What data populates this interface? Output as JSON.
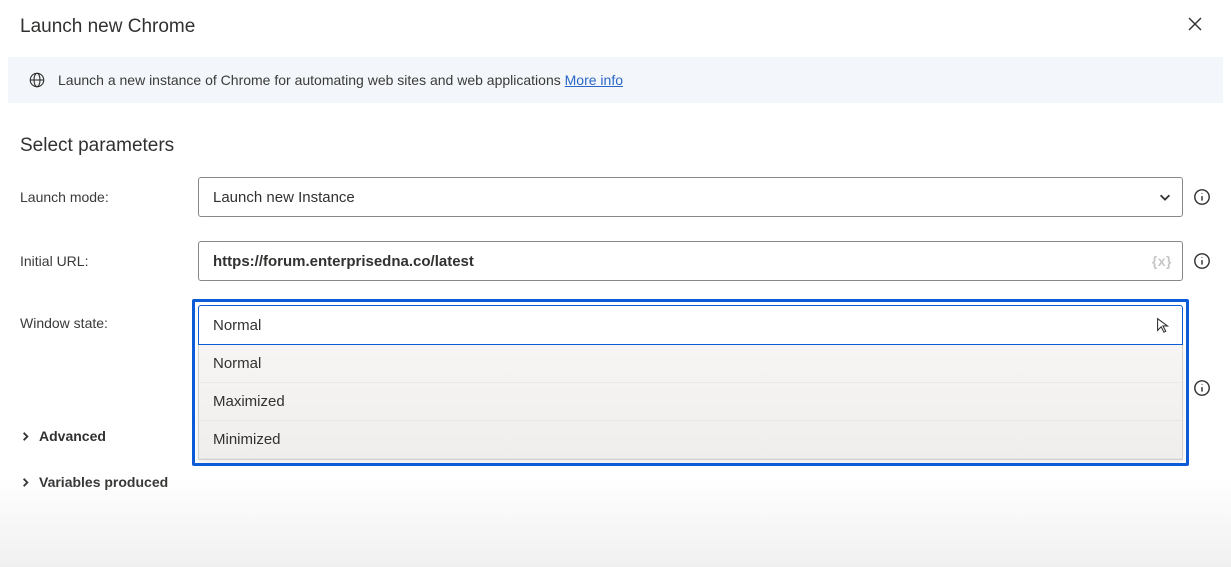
{
  "header": {
    "title": "Launch new Chrome"
  },
  "banner": {
    "text": "Launch a new instance of Chrome for automating web sites and web applications",
    "more_info": "More info"
  },
  "section_title": "Select parameters",
  "fields": {
    "launch_mode": {
      "label": "Launch mode:",
      "value": "Launch new Instance"
    },
    "initial_url": {
      "label": "Initial URL:",
      "value": "https://forum.enterprisedna.co/latest",
      "fx": "{x}"
    },
    "window_state": {
      "label": "Window state:",
      "value": "Normal",
      "options": [
        "Normal",
        "Maximized",
        "Minimized"
      ]
    }
  },
  "collapsibles": {
    "advanced": "Advanced",
    "variables": "Variables produced"
  }
}
